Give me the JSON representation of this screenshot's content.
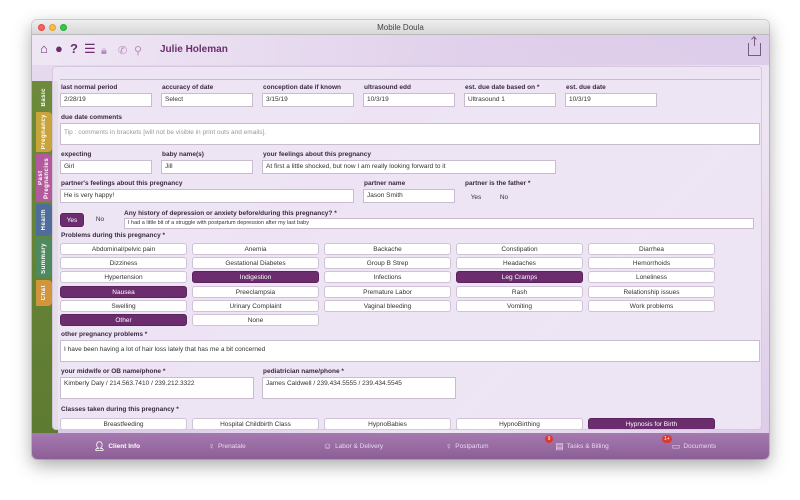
{
  "window": {
    "title": "Mobile Doula"
  },
  "header": {
    "user_name": "Julie Holeman"
  },
  "side_tabs": [
    "Basic",
    "Pregnancy",
    "Past Pregnancies",
    "Health",
    "Summary",
    "Chat"
  ],
  "dates": {
    "last_normal_period": {
      "label": "last normal period",
      "value": "2/28/19"
    },
    "accuracy": {
      "label": "accuracy of date",
      "value": "Select"
    },
    "conception": {
      "label": "conception date if known",
      "value": "3/15/19"
    },
    "ultrasound_edd": {
      "label": "ultrasound edd",
      "value": "10/3/19"
    },
    "due_based_on": {
      "label": "est. due date based on *",
      "value": "Ultrasound 1"
    },
    "est_due": {
      "label": "est. due date",
      "value": "10/3/19"
    }
  },
  "due_comments": {
    "label": "due date comments",
    "placeholder": "Tip : comments in brackets [will not be visible in print outs and emails]."
  },
  "expecting": {
    "label": "expecting",
    "value": "Girl"
  },
  "baby_names": {
    "label": "baby name(s)",
    "value": "Jill"
  },
  "feelings": {
    "label": "your feelings about this pregnancy",
    "value": "At first a little shocked, but now I am really looking forward to it"
  },
  "partner_feelings": {
    "label": "partner's feelings about this pregnancy",
    "value": "He is very happy!"
  },
  "partner_name": {
    "label": "partner name",
    "value": "Jason Smith"
  },
  "partner_father": {
    "label": "partner is the father *",
    "yes": "Yes",
    "no": "No"
  },
  "depression": {
    "yes": "Yes",
    "no": "No",
    "label": "Any history of depression or anxiety before/during this pregnancy? *",
    "value": "I had a little bit of a struggle with postpartum depression after my last baby"
  },
  "problems": {
    "label": "Problems during this pregnancy *",
    "items": [
      "Abdominal/pelvic pain",
      "Anemia",
      "Backache",
      "Constipation",
      "Diarrhea",
      "Dizziness",
      "Gestational Diabetes",
      "Group B Strep",
      "Headaches",
      "Hemorrhoids",
      "Hypertension",
      "Indigestion",
      "Infections",
      "Leg Cramps",
      "Loneliness",
      "Nausea",
      "Preeclampsia",
      "Premature Labor",
      "Rash",
      "Relationship issues",
      "Swelling",
      "Urinary Complaint",
      "Vaginal bleeding",
      "Vomiting",
      "Work problems",
      "Other",
      "None"
    ],
    "selected": [
      "Indigestion",
      "Leg Cramps",
      "Nausea",
      "Other"
    ]
  },
  "other_problems": {
    "label": "other pregnancy problems *",
    "value": "I have been having a lot of hair loss lately that has me a bit concerned"
  },
  "midwife": {
    "label": "your midwife or OB name/phone *",
    "value": "Kimberly Daly / 214.563.7410 / 239.212.3322"
  },
  "pediatrician": {
    "label": "pediatrician name/phone *",
    "value": "James Caldwell / 239.434.5555 / 239.434.5545"
  },
  "classes": {
    "label": "Classes taken during this pregnancy *",
    "items": [
      "Breastfeeding",
      "Hospital Childbirth Class",
      "HypnoBabies",
      "HypnoBirthing",
      "Hypnosis for Birth"
    ]
  },
  "bottom_tabs": [
    {
      "label": "Client Info",
      "icon": "person-icon"
    },
    {
      "label": "Prenatale",
      "icon": "pregnant-icon"
    },
    {
      "label": "Labor & Delivery",
      "icon": "baby-icon"
    },
    {
      "label": "Postpartum",
      "icon": "mother-icon"
    },
    {
      "label": "Tasks & Billing",
      "icon": "tasks-icon",
      "badge": "9"
    },
    {
      "label": "Documents",
      "icon": "documents-icon",
      "badge": "1+"
    }
  ],
  "colors": {
    "accent": "#6b2d6e",
    "side_green": "#6c8a3a"
  }
}
